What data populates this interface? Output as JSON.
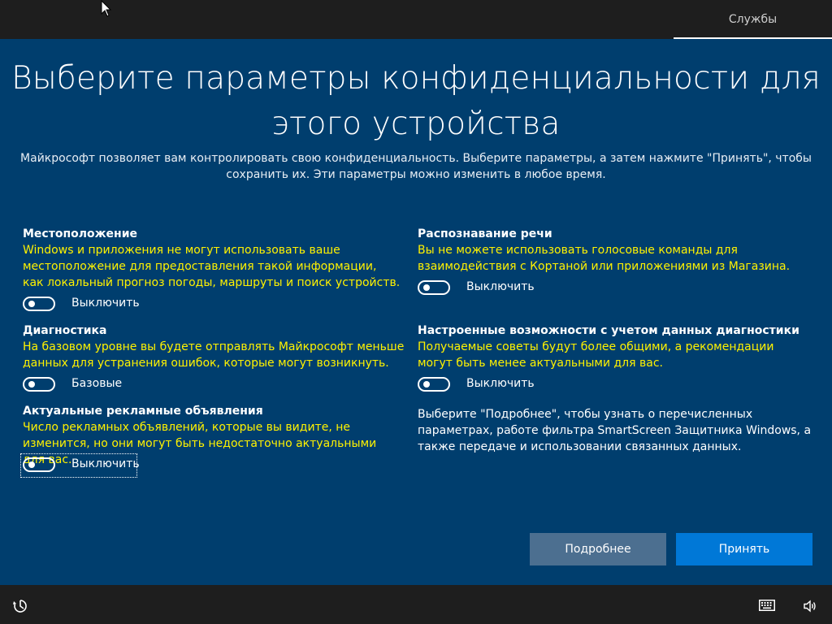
{
  "header": {
    "tab_label": "Службы"
  },
  "title_line1": "Выберите параметры конфиденциальности для",
  "title_line2": "этого устройства",
  "subtitle_line1": "Майкрософт позволяет вам контролировать свою конфиденциальность. Выберите параметры, а затем нажмите \"Принять\", чтобы",
  "subtitle_line2": "сохранить их. Эти параметры можно изменить в любое время.",
  "sections": [
    {
      "title": "Местоположение",
      "desc": "Windows и приложения не могут использовать ваше местоположение для предоставления такой информации, как локальный прогноз погоды, маршруты и поиск устройств.",
      "toggle_label": "Выключить",
      "state": "off"
    },
    {
      "title": "Диагностика",
      "desc": "На базовом уровне вы будете отправлять  Майкрософт меньше данных для устранения ошибок, которые могут возникнуть.",
      "toggle_label": "Базовые",
      "state": "off"
    },
    {
      "title": "Актуальные рекламные объявления",
      "desc": "Число рекламных объявлений, которые вы видите, не изменится, но они могут быть недостаточно актуальными для вас.",
      "toggle_label": "Выключить",
      "state": "off"
    },
    {
      "title": "Распознавание речи",
      "desc": "Вы не можете использовать голосовые команды для взаимодействия с Кортаной или приложениями из Магазина.",
      "toggle_label": "Выключить",
      "state": "off"
    },
    {
      "title": "Настроенные возможности с учетом данных диагностики",
      "desc": "Получаемые советы будут более общими, а рекомендации могут быть менее актуальными для вас.",
      "toggle_label": "Выключить",
      "state": "off"
    }
  ],
  "info_text": "Выберите \"Подробнее\", чтобы узнать о перечисленных параметрах, работе фильтра SmartScreen Защитника Windows, а также передаче и использовании связанных данных.",
  "buttons": {
    "more": "Подробнее",
    "accept": "Принять"
  },
  "icons": {
    "accessibility": "ease-of-access-icon",
    "keyboard": "keyboard-icon",
    "volume": "volume-icon",
    "cursor": "mouse-cursor-icon"
  },
  "colors": {
    "background": "#003e6e",
    "highlight_text": "#fff200",
    "accent_button": "#0078d7",
    "secondary_button": "#4c6f90"
  }
}
